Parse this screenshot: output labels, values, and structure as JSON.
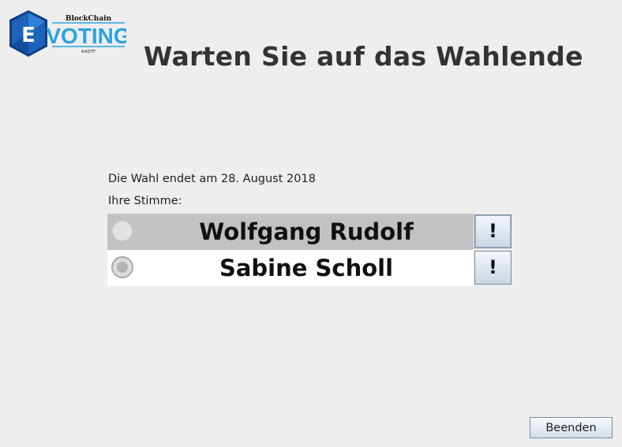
{
  "logo": {
    "letter": "E",
    "word": "VOTING",
    "top_text": "BlockChain",
    "small_text": "AADTF",
    "colors": {
      "blue": "#1c63b9",
      "dark_blue": "#0e3f86",
      "cyan": "#2aa3e0"
    }
  },
  "header": {
    "title": "Warten Sie auf das Wahlende"
  },
  "info": {
    "end_text": "Die Wahl endet am 28. August 2018",
    "vote_label": "Ihre Stimme:"
  },
  "candidates": [
    {
      "name": "Wolfgang Rudolf",
      "selected": false,
      "row_highlight": true,
      "info_label": "!"
    },
    {
      "name": "Sabine Scholl",
      "selected": true,
      "row_highlight": false,
      "info_label": "!"
    }
  ],
  "footer": {
    "end_button_label": "Beenden"
  }
}
